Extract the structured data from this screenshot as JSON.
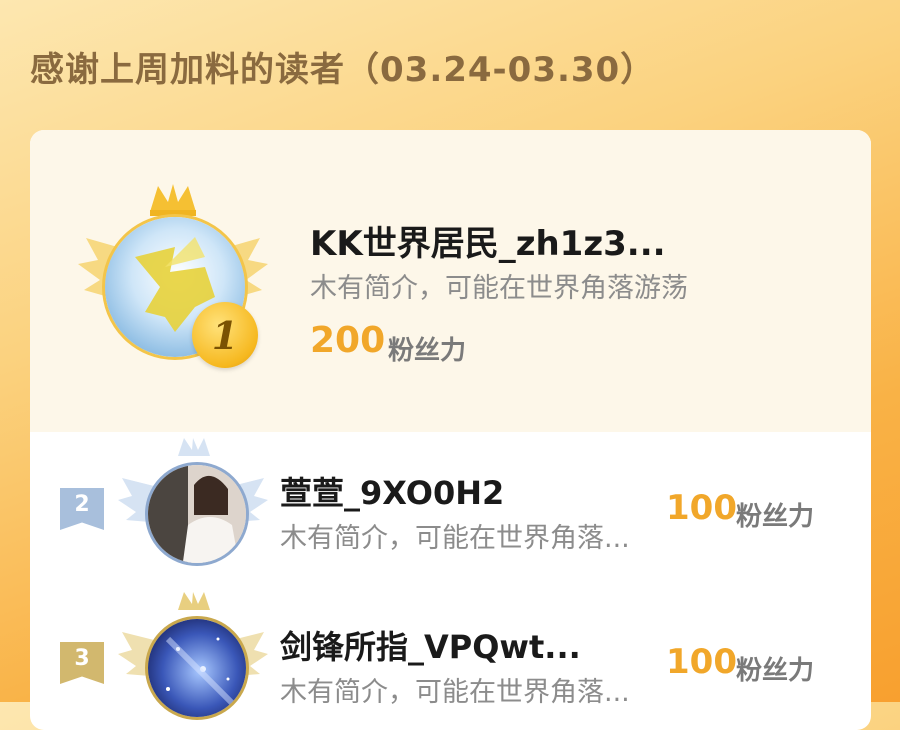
{
  "header": {
    "title": "感谢上周加料的读者（03.24-03.30）"
  },
  "colors": {
    "accent": "#f1a72a",
    "name": "#1a1a1a",
    "bio": "#8c8c8c",
    "unit": "#7a7a7a"
  },
  "top_reader": {
    "rank": "1",
    "name": "KK世界居民_zh1z3...",
    "bio": "木有简介，可能在世界角落游荡",
    "score": "200",
    "unit": "粉丝力",
    "avatar_icon": "golden-pegasus-avatar"
  },
  "readers": [
    {
      "rank": "2",
      "name": "萱萱_9XO0H2",
      "bio": "木有简介，可能在世界角落...",
      "score": "100",
      "unit": "粉丝力",
      "avatar_icon": "photo-avatar"
    },
    {
      "rank": "3",
      "name": "剑锋所指_VPQwt...",
      "bio": "木有简介，可能在世界角落...",
      "score": "100",
      "unit": "粉丝力",
      "avatar_icon": "galaxy-avatar"
    }
  ]
}
